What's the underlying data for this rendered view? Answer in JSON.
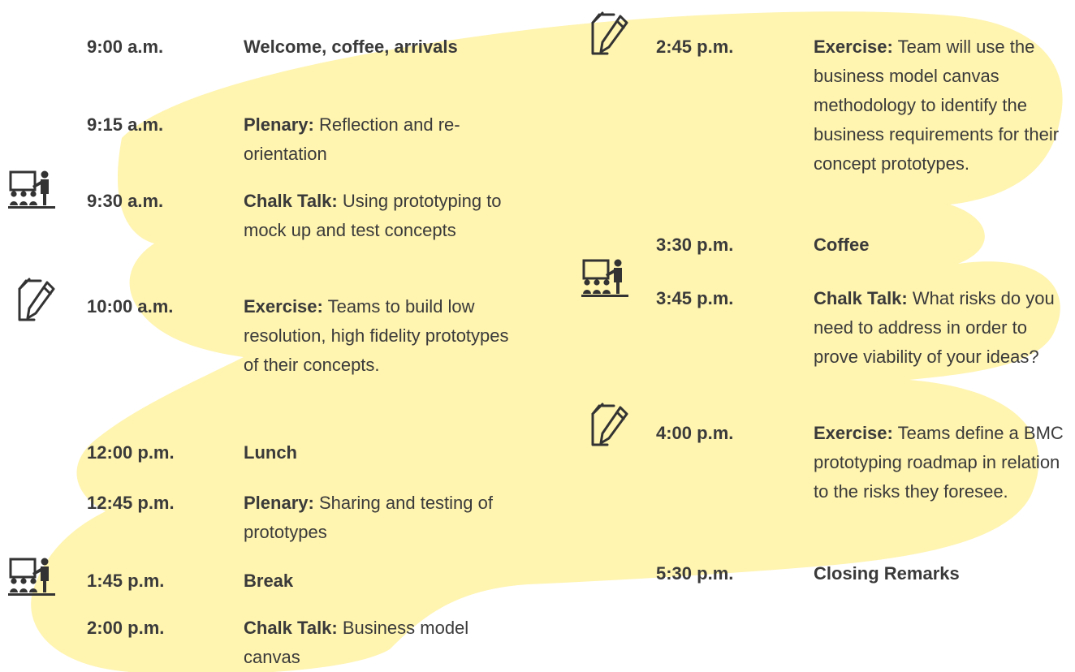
{
  "icons": {
    "presenter": "presenter-board-icon",
    "exercise": "paper-pencil-icon"
  },
  "colors": {
    "highlight": "#FFF4B0",
    "text": "#3A3A3A",
    "icon": "#333333"
  },
  "schedule": {
    "left": [
      {
        "time": "9:00 a.m.",
        "label": "Welcome, coffee, arrivals",
        "desc": "",
        "icon": ""
      },
      {
        "time": "9:15 a.m.",
        "label": "Plenary:",
        "desc": "Reflection and re-orientation",
        "icon": ""
      },
      {
        "time": "9:30 a.m.",
        "label": "Chalk Talk:",
        "desc": "Using prototyping to mock up and test concepts",
        "icon": "presenter-board-icon"
      },
      {
        "time": "10:00 a.m.",
        "label": "Exercise:",
        "desc": "Teams to build low resolution, high fidelity prototypes of their concepts.",
        "icon": "paper-pencil-icon"
      },
      {
        "time": "12:00 p.m.",
        "label": "Lunch",
        "desc": "",
        "icon": ""
      },
      {
        "time": "12:45 p.m.",
        "label": "Plenary:",
        "desc": "Sharing and testing of prototypes",
        "icon": ""
      },
      {
        "time": "1:45 p.m.",
        "label": "Break",
        "desc": "",
        "icon": ""
      },
      {
        "time": "2:00 p.m.",
        "label": "Chalk Talk:",
        "desc": "Business model canvas",
        "icon": "presenter-board-icon"
      }
    ],
    "right": [
      {
        "time": "2:45 p.m.",
        "label": "Exercise:",
        "desc": "Team will use the business model canvas methodology to identify the business requirements for their concept prototypes.",
        "icon": "paper-pencil-icon"
      },
      {
        "time": "3:30 p.m.",
        "label": "Coffee",
        "desc": "",
        "icon": ""
      },
      {
        "time": "3:45 p.m.",
        "label": "Chalk Talk:",
        "desc": "What risks do you need to address in order to prove viability of your ideas?",
        "icon": "presenter-board-icon"
      },
      {
        "time": "4:00 p.m.",
        "label": "Exercise:",
        "desc": "Teams define a BMC prototyping roadmap in relation to the risks they foresee.",
        "icon": "paper-pencil-icon"
      },
      {
        "time": "5:30 p.m.",
        "label": "Closing Remarks",
        "desc": "",
        "icon": ""
      }
    ]
  }
}
